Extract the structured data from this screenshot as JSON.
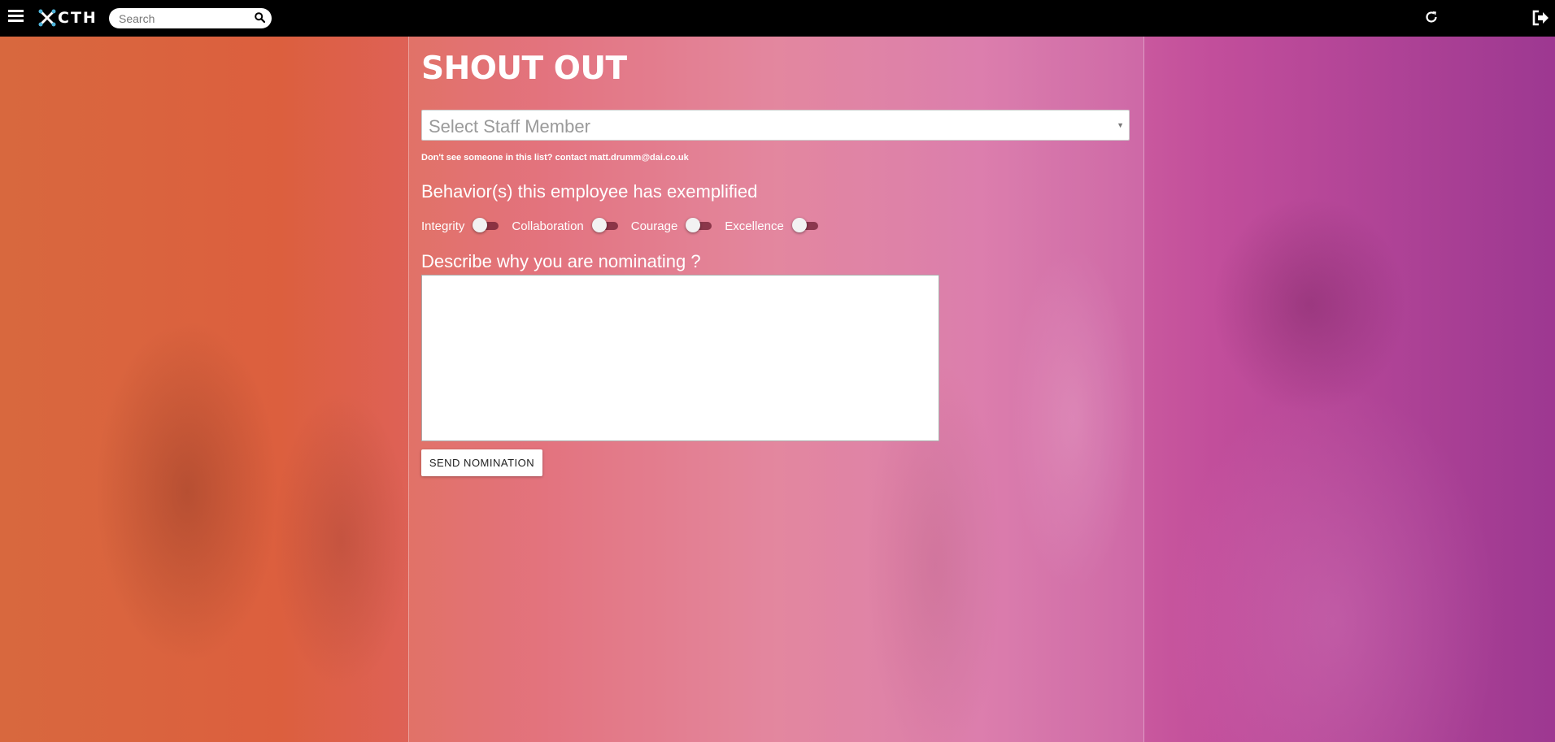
{
  "header": {
    "logo_text": "CTH",
    "search_placeholder": "Search",
    "icons": [
      "menu-icon",
      "logo-icon",
      "search-icon",
      "refresh-icon",
      "logout-icon"
    ]
  },
  "form": {
    "title": "SHOUT OUT",
    "staff_select_placeholder": "Select Staff Member",
    "hint": "Don't see someone in this list? contact matt.drumm@dai.co.uk",
    "behaviors_title": "Behavior(s) this employee has exemplified",
    "behaviors": [
      {
        "label": "Integrity",
        "checked": false
      },
      {
        "label": "Collaboration",
        "checked": false
      },
      {
        "label": "Courage",
        "checked": false
      },
      {
        "label": "Excellence",
        "checked": false
      }
    ],
    "reason_title": "Describe why you are nominating ?",
    "reason_value": "",
    "send_label": "SEND NOMINATION"
  },
  "colors": {
    "topbar": "#000000",
    "accent_logo": "#4fb3d9"
  }
}
